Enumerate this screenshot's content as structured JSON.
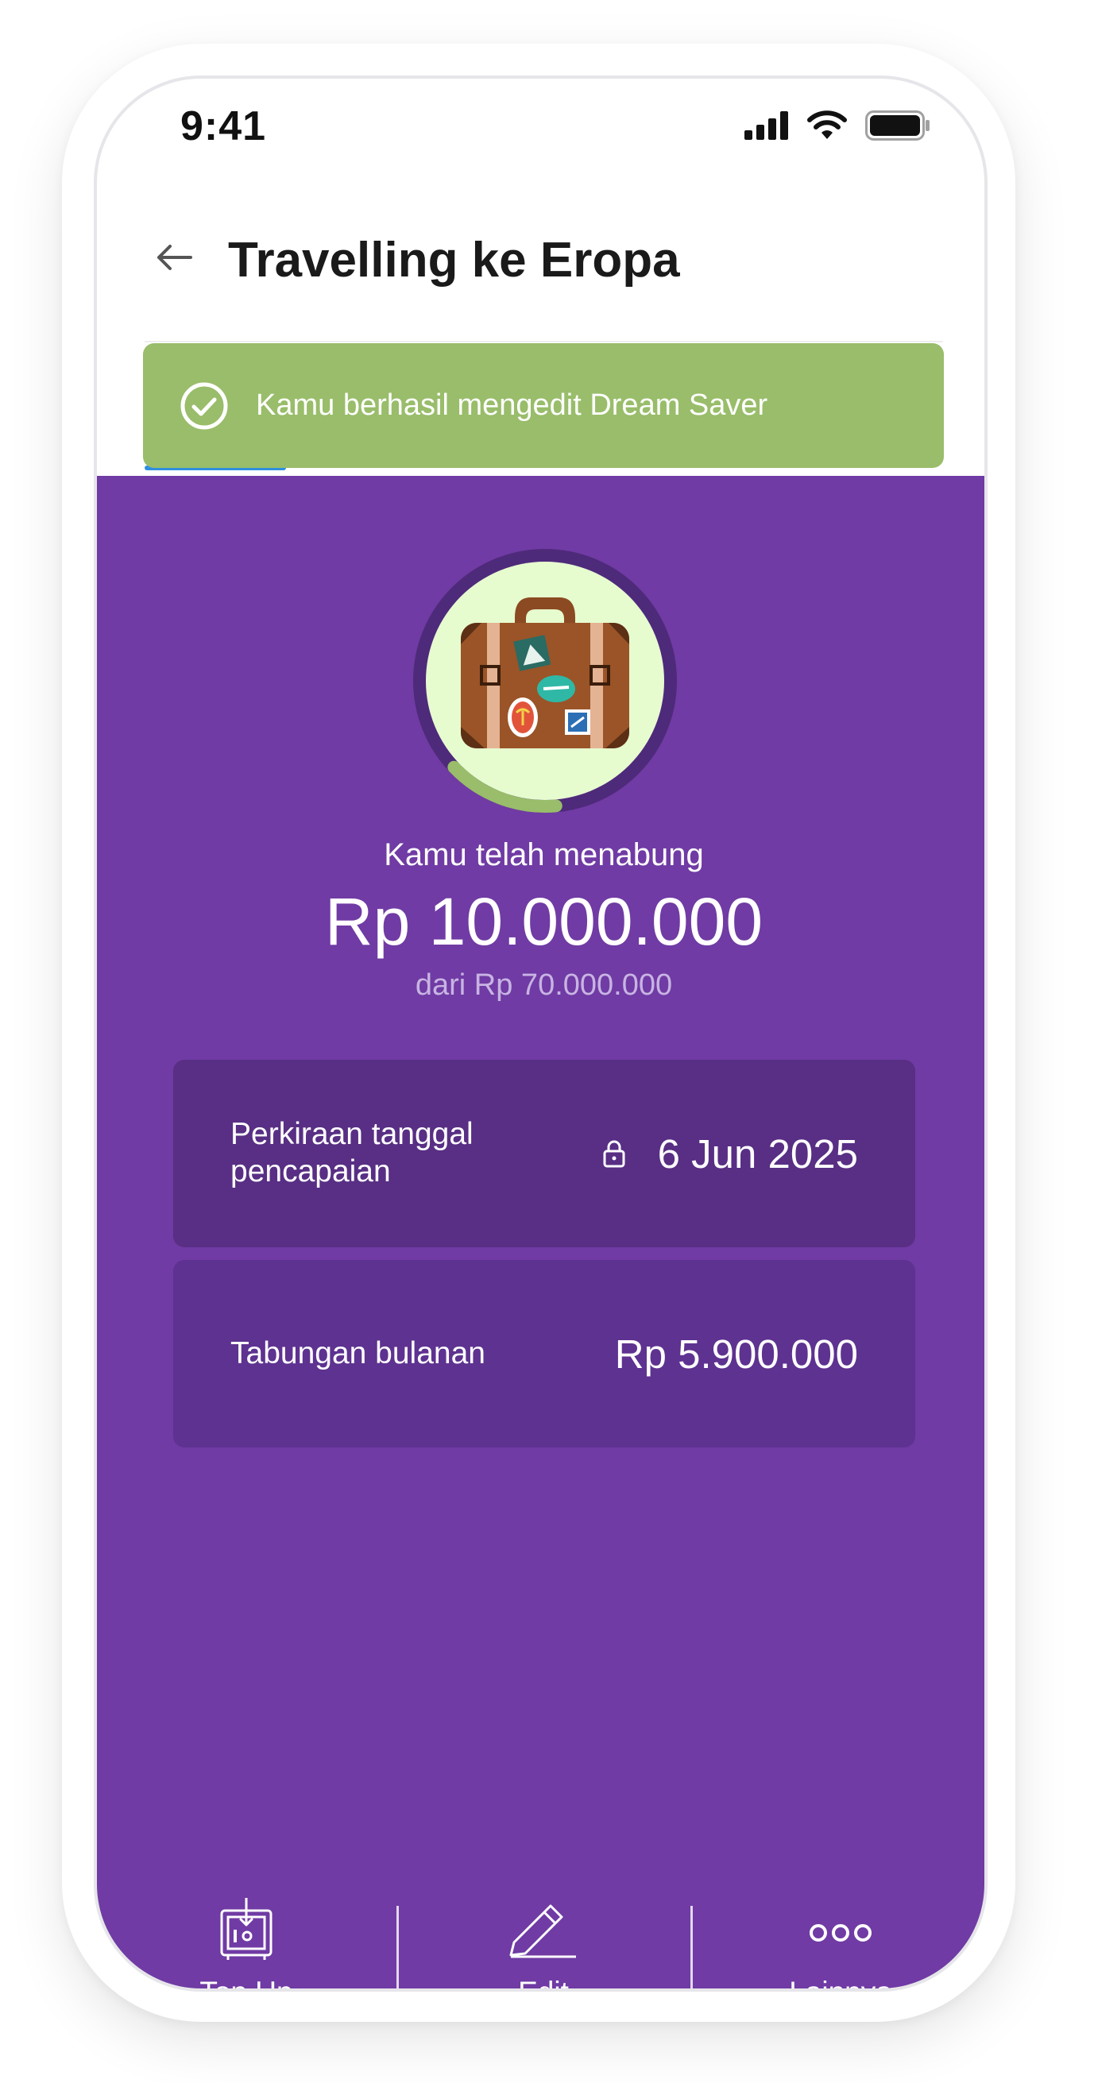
{
  "status_bar": {
    "time": "9:41"
  },
  "header": {
    "title": "Travelling ke Eropa"
  },
  "toast": {
    "message": "Kamu berhasil mengedit Dream Saver"
  },
  "goal": {
    "image": "suitcase-illustration",
    "saved_label": "Kamu telah menabung",
    "saved_amount": "Rp 10.000.000",
    "target_text": "dari Rp 70.000.000",
    "progress_fraction": 0.143
  },
  "cards": {
    "estimate": {
      "label_line1": "Perkiraan tanggal",
      "label_line2": "pencapaian",
      "value": "6 Jun 2025",
      "icon": "lock-icon"
    },
    "monthly": {
      "label": "Tabungan bulanan",
      "value": "Rp 5.900.000"
    }
  },
  "actions": [
    {
      "label": "Top Up",
      "icon": "safe-deposit-icon"
    },
    {
      "label": "Edit",
      "icon": "pencil-icon"
    },
    {
      "label": "Lainnya",
      "icon": "more-dots-icon"
    }
  ],
  "colors": {
    "purple": "#703ba4",
    "card_dark": "#582f84",
    "card_mid": "#5e3290",
    "toast_green": "#99bd6a",
    "ring_green": "#99bd6a",
    "ring_track": "#4e2a7a",
    "circle_fill": "#e6fccf",
    "tab_blue": "#2f8fe0"
  }
}
